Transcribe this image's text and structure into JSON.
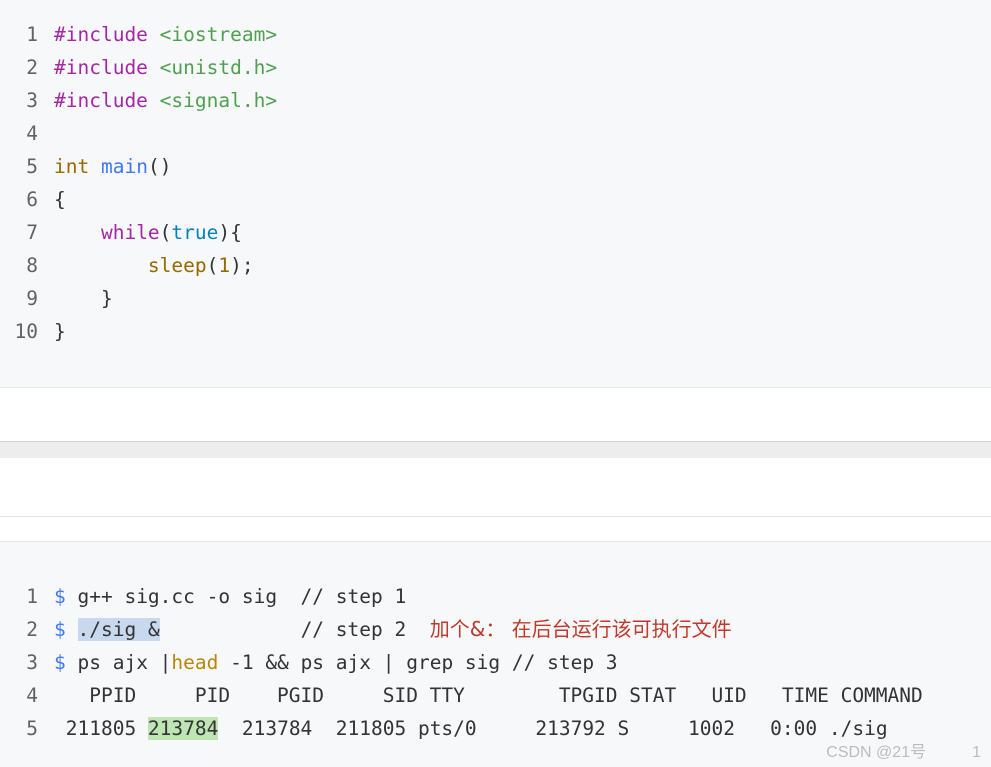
{
  "top_code": {
    "lines": [
      {
        "n": "1",
        "t1": "#include",
        "t2": " ",
        "t3": "<iostream>"
      },
      {
        "n": "2",
        "t1": "#include",
        "t2": " ",
        "t3": "<unistd.h>"
      },
      {
        "n": "3",
        "t1": "#include",
        "t2": " ",
        "t3": "<signal.h>"
      },
      {
        "n": "4"
      },
      {
        "n": "5",
        "t1": "int",
        "t2": " ",
        "t3": "main",
        "t4": "()"
      },
      {
        "n": "6",
        "t1": "{"
      },
      {
        "n": "7",
        "indent": "    ",
        "t1": "while",
        "t2": "(",
        "t3": "true",
        "t4": "){"
      },
      {
        "n": "8",
        "indent": "        ",
        "t1": "sleep",
        "t2": "(",
        "t3": "1",
        "t4": ");"
      },
      {
        "n": "9",
        "indent": "    ",
        "t1": "}"
      },
      {
        "n": "10",
        "t1": "}"
      }
    ]
  },
  "bottom_code": {
    "lines": [
      {
        "n": "1",
        "prompt": "$",
        "text": " g++ sig.cc -o sig  // step 1"
      },
      {
        "n": "2",
        "prompt": "$",
        "sel": "./sig &",
        "text": "            // step 2  ",
        "note": "加个&： 在后台运行该可执行文件"
      },
      {
        "n": "3",
        "prompt": "$",
        "a": " ps ajx |",
        "head": "head",
        "b": " -1 && ps ajx | grep sig // step 3"
      },
      {
        "n": "4",
        "text": "   PPID     PID    PGID     SID TTY        TPGID STAT   UID   TIME COMMAND"
      },
      {
        "n": "5",
        "pre": " 211805 ",
        "pid": "213784",
        "post": "  213784  211805 pts/0     213792 S     1002   0:00 ./sig"
      }
    ]
  },
  "watermark": "CSDN @21号",
  "watermark_tail": "1"
}
